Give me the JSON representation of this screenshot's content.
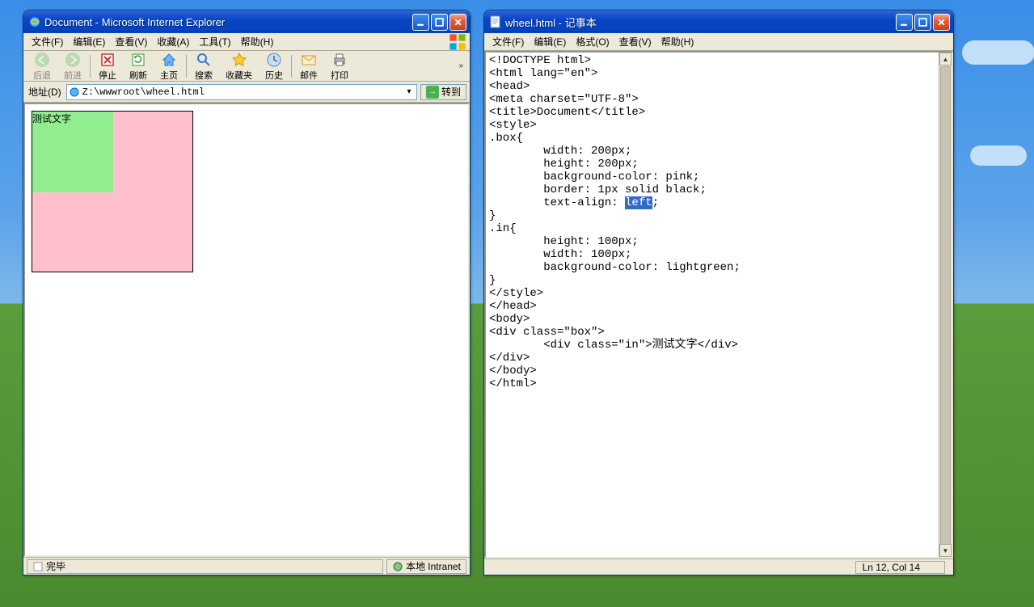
{
  "ie": {
    "title": "Document - Microsoft Internet Explorer",
    "menu": [
      "文件(F)",
      "编辑(E)",
      "查看(V)",
      "收藏(A)",
      "工具(T)",
      "帮助(H)"
    ],
    "toolbar": {
      "back": "后退",
      "forward": "前进",
      "stop": "停止",
      "refresh": "刷新",
      "home": "主页",
      "search": "搜索",
      "favorites": "收藏夹",
      "history": "历史",
      "mail": "邮件",
      "print": "打印"
    },
    "addr_label": "地址(D)",
    "addr_value": "Z:\\wwwroot\\wheel.html",
    "go_label": "转到",
    "page_text": "测试文字",
    "status_left": "完毕",
    "status_right": "本地 Intranet"
  },
  "np": {
    "title": "wheel.html - 记事本",
    "menu": [
      "文件(F)",
      "编辑(E)",
      "格式(O)",
      "查看(V)",
      "帮助(H)"
    ],
    "code": {
      "l1": "<!DOCTYPE html>",
      "l2": "<html lang=\"en\">",
      "l3": "<head>",
      "l4": "<meta charset=\"UTF-8\">",
      "l5": "<title>Document</title>",
      "l6": "<style>",
      "l7": ".box{",
      "l8": "        width: 200px;",
      "l9": "        height: 200px;",
      "l10": "        background-color: pink;",
      "l11": "        border: 1px solid black;",
      "l12a": "        text-align: ",
      "l12sel": "left",
      "l12b": ";",
      "l13": "}",
      "l14": ".in{",
      "l15": "        height: 100px;",
      "l16": "        width: 100px;",
      "l17": "        background-color: lightgreen;",
      "l18": "}",
      "l19": "</style>",
      "l20": "</head>",
      "l21": "<body>",
      "l22": "<div class=\"box\">",
      "l23": "        <div class=\"in\">测试文字</div>",
      "l24": "</div>",
      "l25": "</body>",
      "l26": "</html>"
    },
    "status": "Ln 12, Col 14"
  }
}
